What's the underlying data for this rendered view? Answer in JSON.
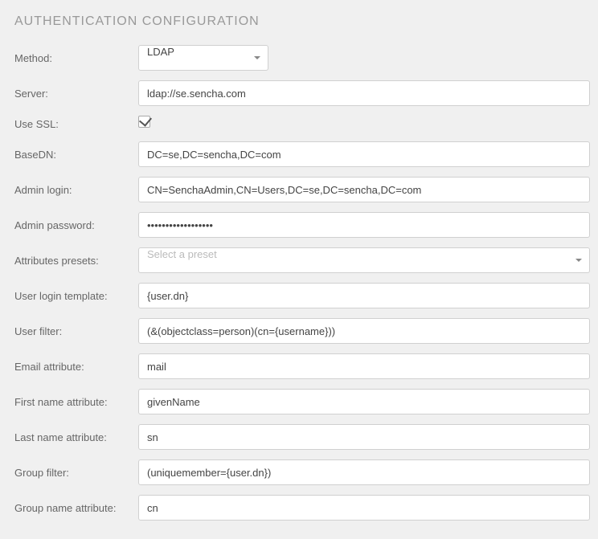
{
  "title": "AUTHENTICATION CONFIGURATION",
  "labels": {
    "method": "Method:",
    "server": "Server:",
    "use_ssl": "Use SSL:",
    "base_dn": "BaseDN:",
    "admin_login": "Admin login:",
    "admin_password": "Admin password:",
    "attributes_presets": "Attributes presets:",
    "user_login_template": "User login template:",
    "user_filter": "User filter:",
    "email_attribute": "Email attribute:",
    "first_name_attribute": "First name attribute:",
    "last_name_attribute": "Last name attribute:",
    "group_filter": "Group filter:",
    "group_name_attribute": "Group name attribute:"
  },
  "values": {
    "method": "LDAP",
    "server": "ldap://se.sencha.com",
    "use_ssl": true,
    "base_dn": "DC=se,DC=sencha,DC=com",
    "admin_login": "CN=SenchaAdmin,CN=Users,DC=se,DC=sencha,DC=com",
    "admin_password": "••••••••••••••••••",
    "attributes_presets": "",
    "attributes_presets_placeholder": "Select a preset",
    "user_login_template": "{user.dn}",
    "user_filter": "(&(objectclass=person)(cn={username}))",
    "email_attribute": "mail",
    "first_name_attribute": "givenName",
    "last_name_attribute": "sn",
    "group_filter": "(uniquemember={user.dn})",
    "group_name_attribute": "cn"
  }
}
